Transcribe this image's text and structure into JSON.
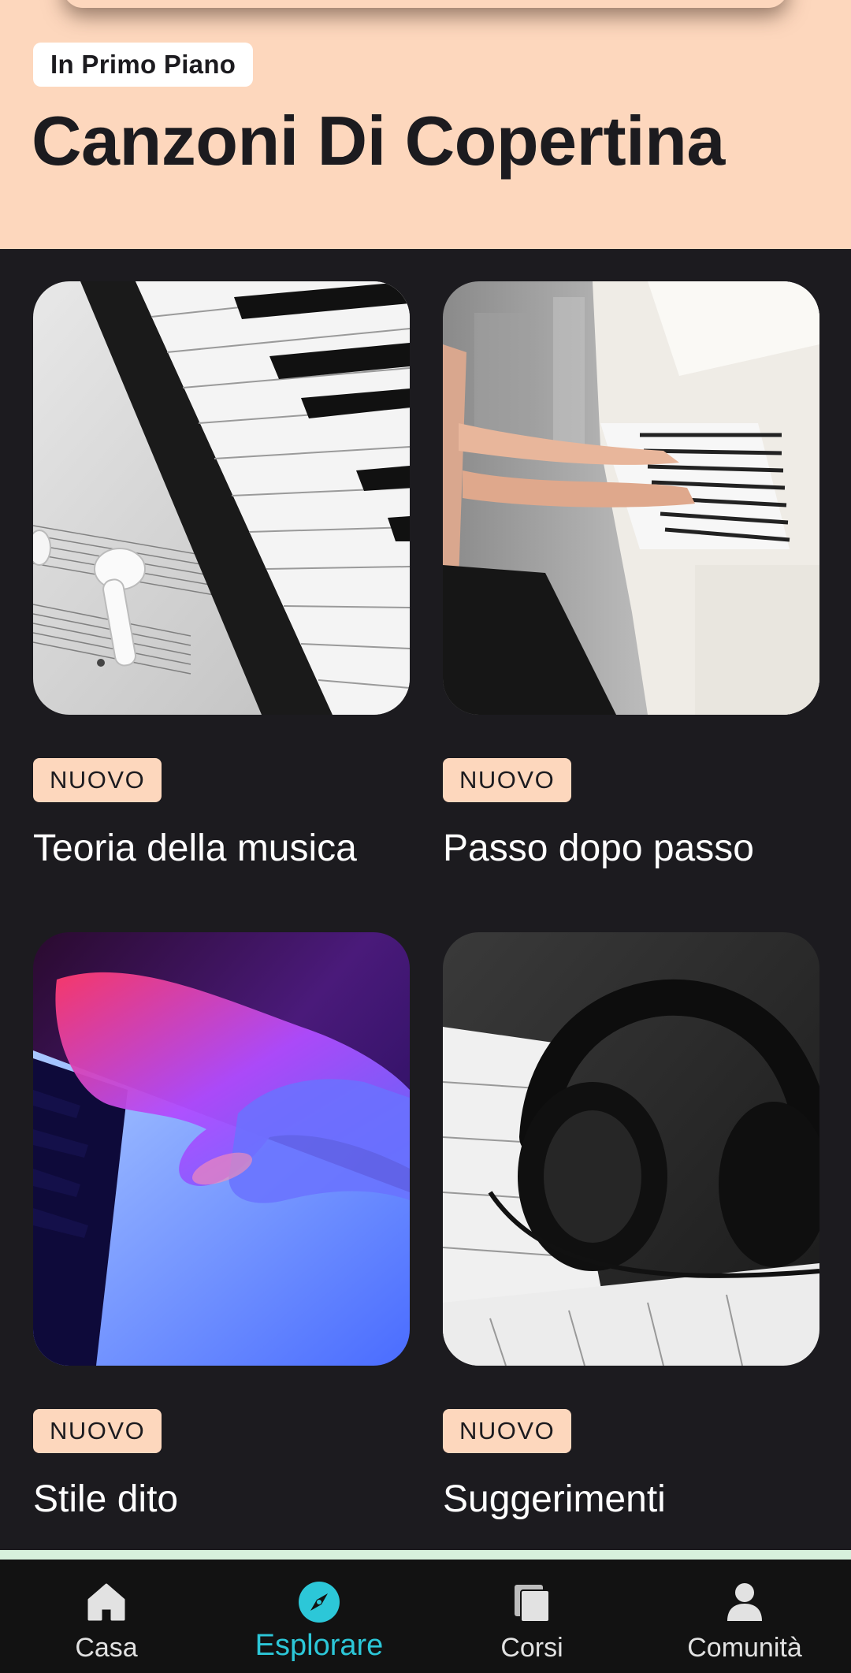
{
  "header": {
    "chip_label": "In Primo Piano",
    "title": "Canzoni Di Copertina",
    "background_color": "#fdd7bd"
  },
  "cards": [
    {
      "badge": "NUOVO",
      "title": "Teoria della musica",
      "image": "piano-keys-sheet-music-earbuds"
    },
    {
      "badge": "NUOVO",
      "title": "Passo dopo passo",
      "image": "person-playing-white-piano"
    },
    {
      "badge": "NUOVO",
      "title": "Stile dito",
      "image": "hands-on-keyboard-neon"
    },
    {
      "badge": "NUOVO",
      "title": "Suggerimenti",
      "image": "headphones-on-piano"
    }
  ],
  "bottom_nav": {
    "active": "Esplorare",
    "active_color": "#2cc7d8",
    "items": [
      {
        "label": "Casa",
        "icon": "home-icon"
      },
      {
        "label": "Esplorare",
        "icon": "compass-icon"
      },
      {
        "label": "Corsi",
        "icon": "courses-icon"
      },
      {
        "label": "Comunità",
        "icon": "person-icon"
      }
    ]
  }
}
